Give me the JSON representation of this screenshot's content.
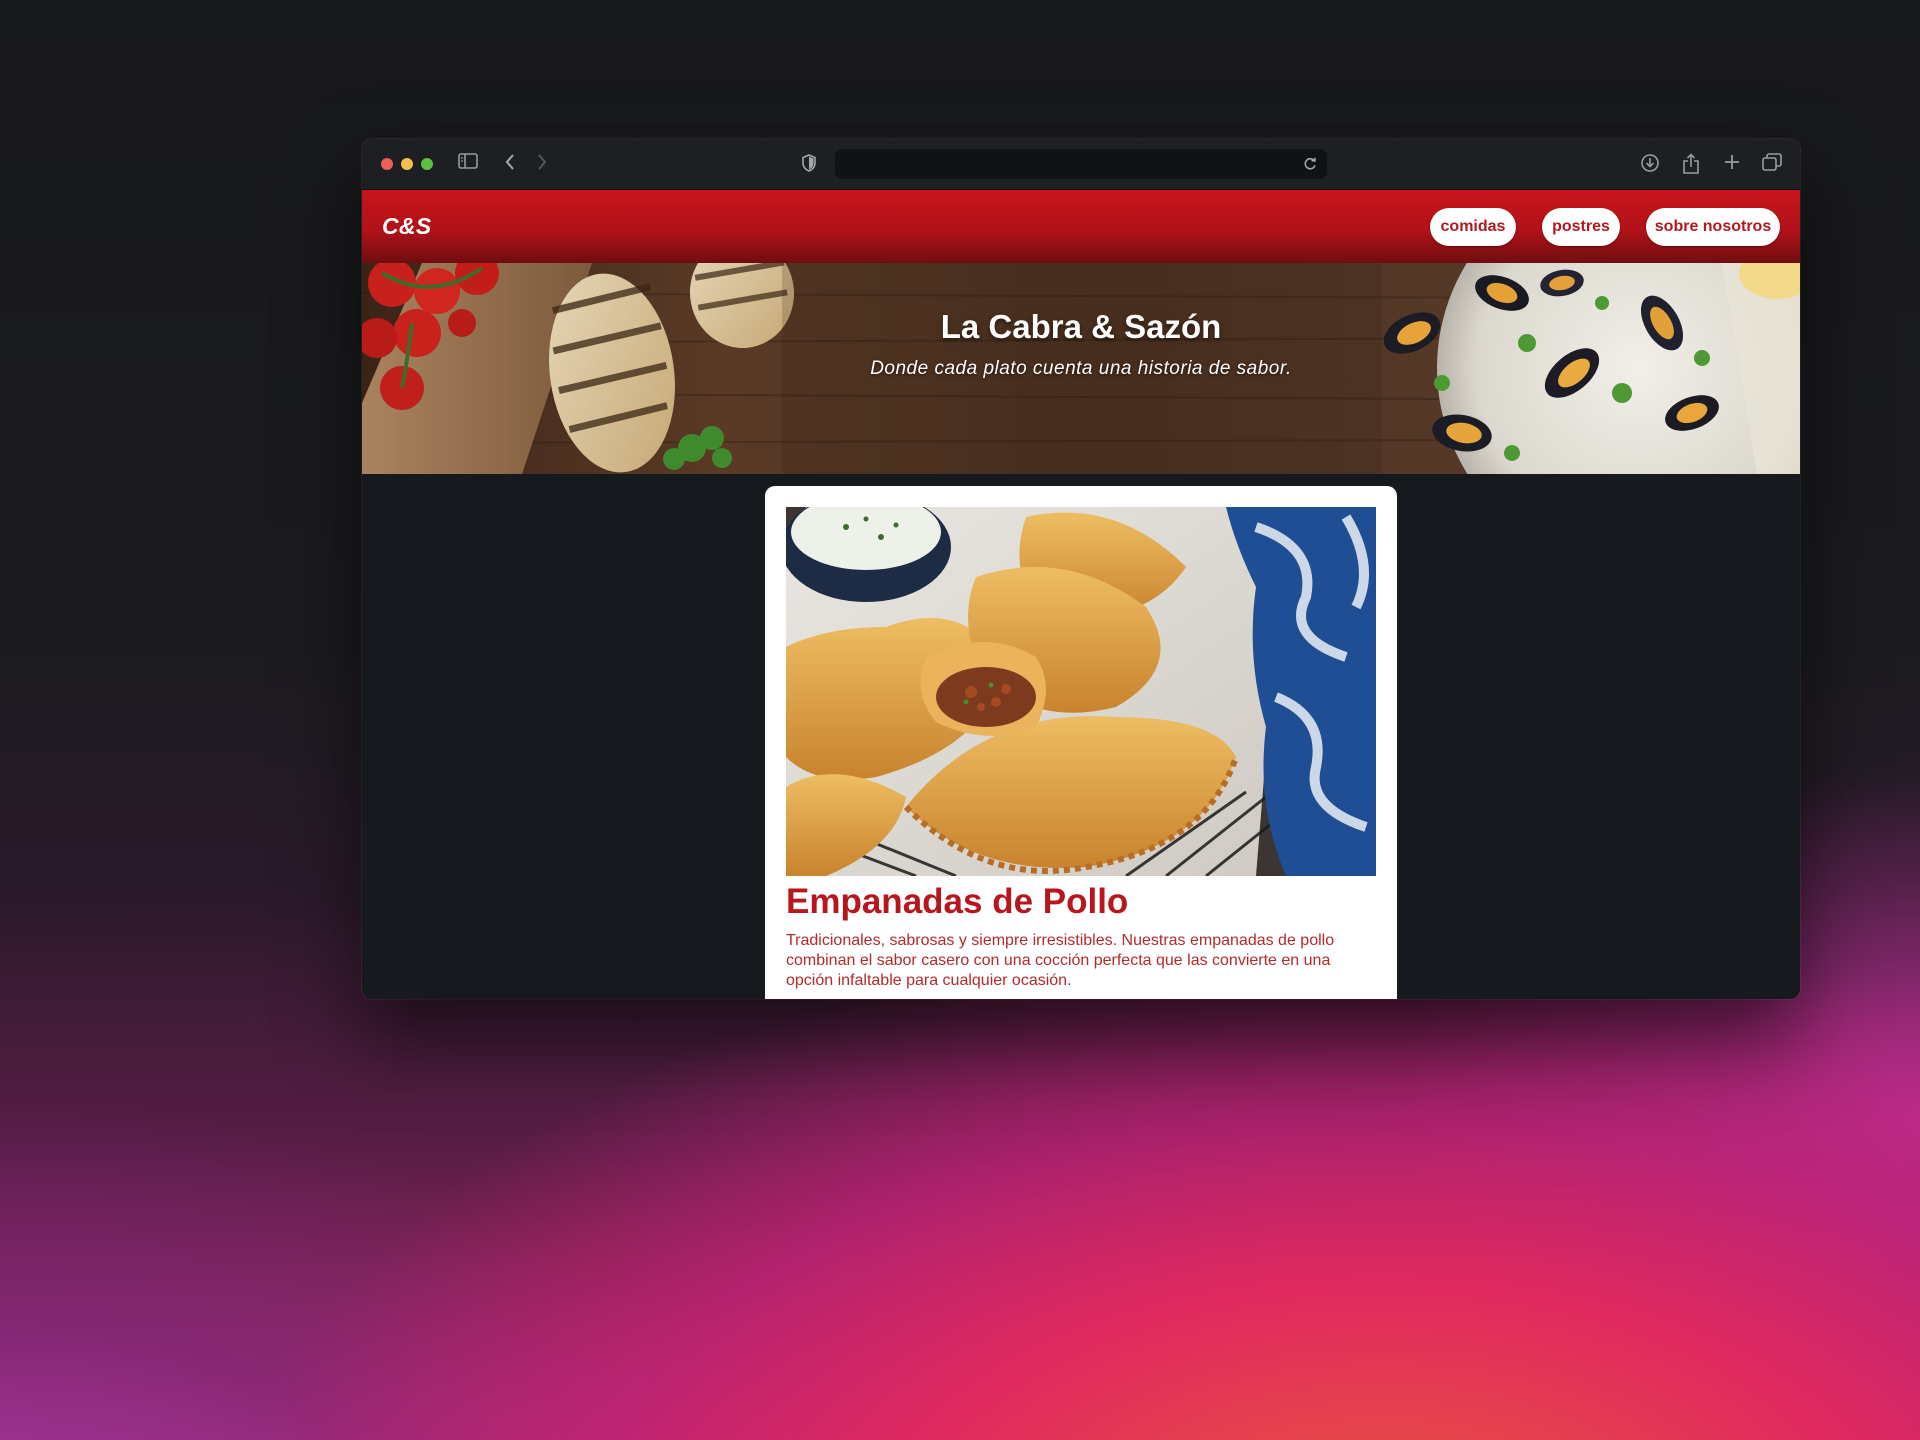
{
  "browser": {
    "url": "",
    "icons": [
      "sidebar-icon",
      "back-icon",
      "forward-icon",
      "shield-icon",
      "reload-icon",
      "download-icon",
      "share-icon",
      "new-tab-icon",
      "tabs-icon"
    ]
  },
  "site": {
    "logo": "C&S",
    "nav": [
      {
        "label": "comidas"
      },
      {
        "label": "postres"
      },
      {
        "label": "sobre nosotros"
      }
    ],
    "hero": {
      "title": "La Cabra & Sazón",
      "subtitle": "Donde cada plato cuenta una historia de sabor."
    },
    "card": {
      "title": "Empanadas de Pollo",
      "description": "Tradicionales, sabrosas y siempre irresistibles. Nuestras empanadas de pollo combinan el sabor casero con una cocción perfecta que las convierte en una opción infaltable para cualquier ocasión."
    }
  },
  "colors": {
    "brand_red": "#b8161d",
    "nav_red": "#c8141c",
    "page_bg": "#16191d"
  }
}
